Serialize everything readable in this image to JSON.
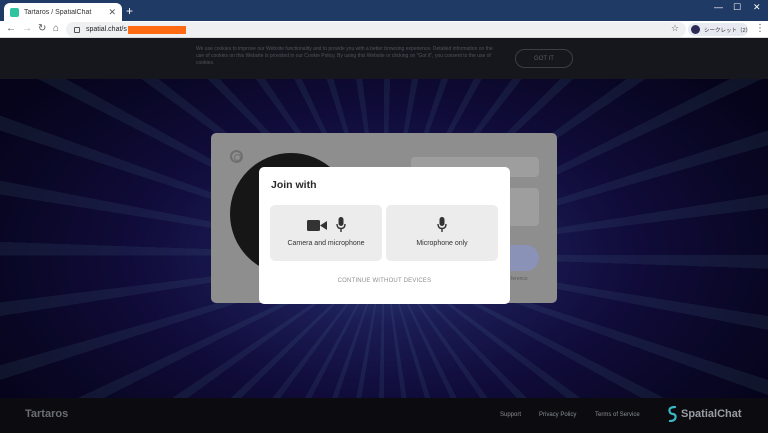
{
  "browser": {
    "tab_title": "Tartaros / SpatialChat",
    "tab_close": "✕",
    "new_tab": "+",
    "url_prefix": "spatial.chat/s",
    "profile_label": "シークレット（2）",
    "window_controls": {
      "minimize": "—",
      "maximize": "☐",
      "close": "✕"
    }
  },
  "cookie_banner": {
    "text": "We use cookies to improve our Website functionality and to provide you with a better browsing experience. Detailed information on the use of cookies on this Website is provided in our Cookie Policy. By using this Website or clicking on \"Got it\", you consent to the use of cookies.",
    "button": "GOT IT"
  },
  "background_card": {
    "side_text": "ference"
  },
  "modal": {
    "title": "Join with",
    "options": [
      {
        "label": "Camera and microphone",
        "icons": [
          "camera-icon",
          "microphone-icon"
        ]
      },
      {
        "label": "Microphone only",
        "icons": [
          "microphone-icon"
        ]
      }
    ],
    "skip_label": "CONTINUE WITHOUT DEVICES"
  },
  "footer": {
    "brand": "Tartaros",
    "links": [
      "Support",
      "Privacy Policy",
      "Terms of Service"
    ],
    "logo_text": "SpatialChat"
  },
  "colors": {
    "tabbar": "#203a66",
    "redaction": "#ff6a13",
    "modal_bg": "#ffffff",
    "option_bg": "#ececec"
  }
}
